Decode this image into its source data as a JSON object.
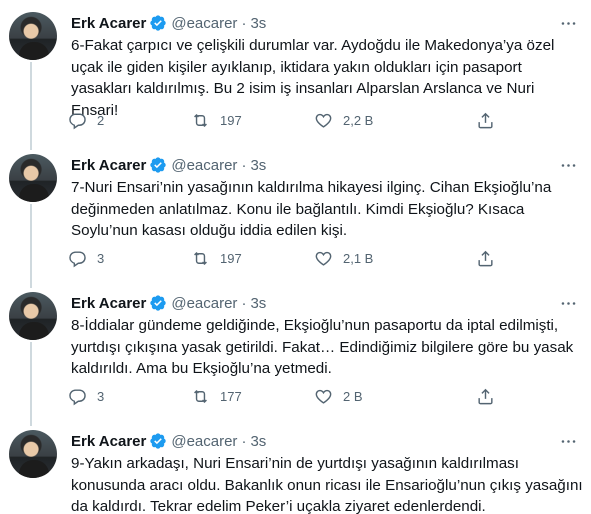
{
  "tweets": [
    {
      "author": "Erk Acarer",
      "handle": "@eacarer",
      "separator": "·",
      "time": "3s",
      "text": "6-Fakat çarpıcı ve çelişkili durumlar var. Aydoğdu ile Makedonya’ya özel\nuçak ile giden kişiler ayıklanıp, iktidara yakın oldukları için pasaport\nyasakları kaldırılmış. Bu 2 isim iş insanları Alparslan Arslanca ve Nuri Ensari!",
      "replies": "2",
      "retweets": "197",
      "likes": "2,2 B"
    },
    {
      "author": "Erk Acarer",
      "handle": "@eacarer",
      "separator": "·",
      "time": "3s",
      "text": "7-Nuri Ensari’nin yasağının kaldırılma hikayesi ilginç. Cihan Ekşioğlu’na\ndeğinmeden anlatılmaz. Konu ile bağlantılı. Kimdi Ekşioğlu? Kısaca\nSoylu’nun kasası olduğu iddia edilen kişi.",
      "replies": "3",
      "retweets": "197",
      "likes": "2,1 B"
    },
    {
      "author": "Erk Acarer",
      "handle": "@eacarer",
      "separator": "·",
      "time": "3s",
      "text": "8-İddialar gündeme geldiğinde, Ekşioğlu’nun pasaportu da iptal edilmişti,\nyurtdışı çıkışına yasak getirildi. Fakat… Edindiğimiz bilgilere göre bu yasak\nkaldırıldı. Ama bu Ekşioğlu’na yetmedi.",
      "replies": "3",
      "retweets": "177",
      "likes": "2 B"
    },
    {
      "author": "Erk Acarer",
      "handle": "@eacarer",
      "separator": "·",
      "time": "3s",
      "text": "9-Yakın arkadaşı, Nuri Ensari’nin de yurtdışı yasağının kaldırılması\nkonusunda aracı oldu. Bakanlık onun ricası ile Ensarioğlu’nun çıkış yasağını\nda kaldırdı. Tekrar edelim Peker’i uçakla ziyaret edenlerdendi."
    }
  ],
  "icons": {
    "verified": "verified-badge-icon",
    "more": "more-horizontal-icon",
    "reply": "reply-icon",
    "retweet": "retweet-icon",
    "like": "heart-icon",
    "share": "share-icon"
  },
  "colors": {
    "text": "#0f1419",
    "secondary": "#536471",
    "verified": "#1d9bf0",
    "thread_line": "#cfd9de"
  }
}
